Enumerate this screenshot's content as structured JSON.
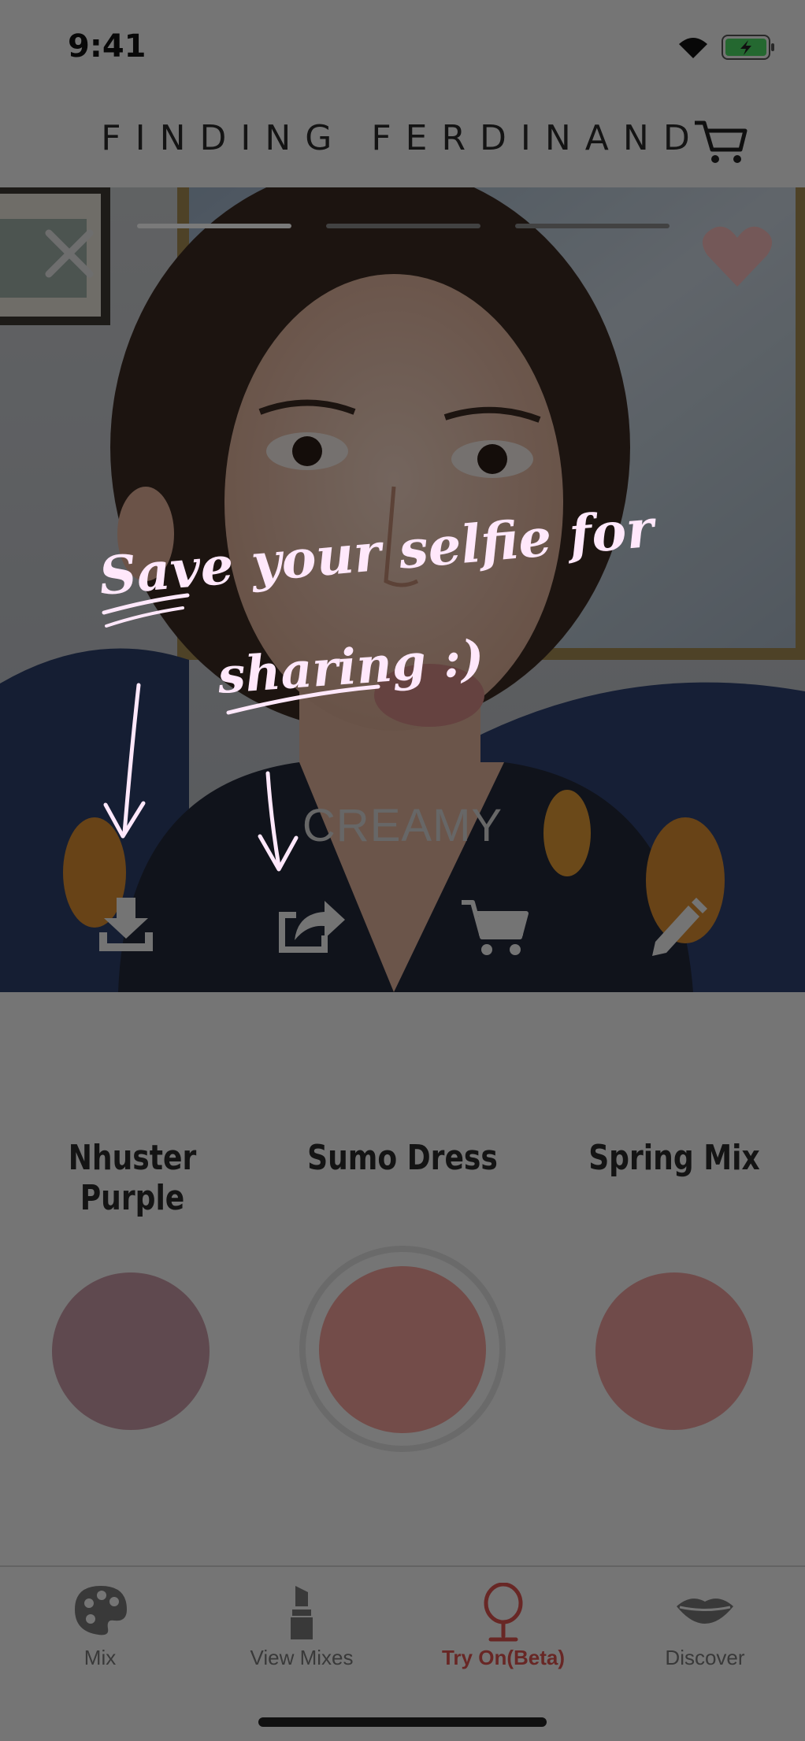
{
  "status_bar": {
    "time": "9:41"
  },
  "header": {
    "title": "FINDING FERDINAND",
    "cart_icon": "cart-icon"
  },
  "photo": {
    "close_icon": "close-icon",
    "favorite_icon": "heart-icon",
    "progress_segments": 3,
    "finish_label": "CREAMY",
    "actions": [
      {
        "name": "download-icon"
      },
      {
        "name": "share-icon"
      },
      {
        "name": "cart-icon"
      },
      {
        "name": "pencil-icon"
      }
    ]
  },
  "tutorial": {
    "line1": "Save your selfie for",
    "line2": "sharing :)"
  },
  "shades": [
    {
      "name": "Nhuster Purple",
      "color": "#c79aa5"
    },
    {
      "name": "Sumo Dress",
      "color": "#f0a09a"
    },
    {
      "name": "Spring Mix",
      "color": "#eb9d9c"
    }
  ],
  "tabs": [
    {
      "label": "Mix",
      "icon": "palette-icon",
      "active": false
    },
    {
      "label": "View Mixes",
      "icon": "lipstick-icon",
      "active": false
    },
    {
      "label": "Try On(Beta)",
      "icon": "mirror-icon",
      "active": true
    },
    {
      "label": "Discover",
      "icon": "lips-icon",
      "active": false
    }
  ],
  "colors": {
    "accent": "#d9534f",
    "tutorial_ink": "#ffe8fb"
  }
}
